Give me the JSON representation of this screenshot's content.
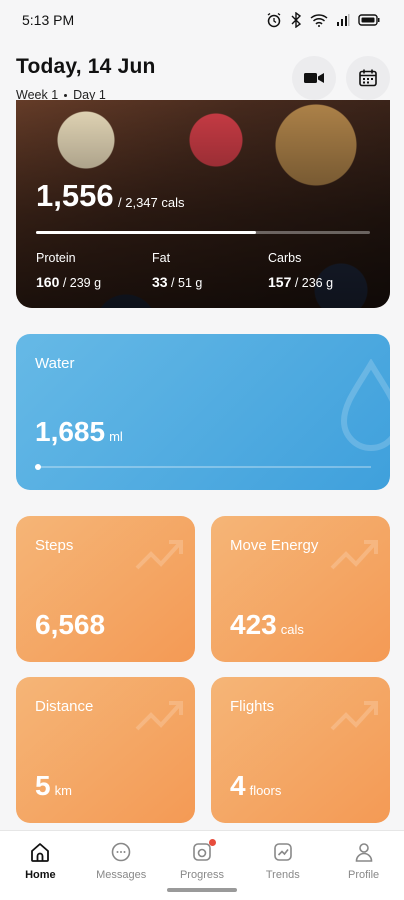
{
  "status_bar": {
    "time": "5:13 PM"
  },
  "header": {
    "title": "Today, 14 Jun",
    "week": "Week 1",
    "day": "Day 1"
  },
  "calories": {
    "consumed": "1,556",
    "goal": "/ 2,347 cals",
    "progress": 0.66,
    "macros": [
      {
        "label": "Protein",
        "value": "160",
        "target": " / 239 g"
      },
      {
        "label": "Fat",
        "value": "33",
        "target": " / 51 g"
      },
      {
        "label": "Carbs",
        "value": "157",
        "target": " / 236 g"
      }
    ]
  },
  "water": {
    "label": "Water",
    "value": "1,685",
    "unit": "ml",
    "progress": 0.0
  },
  "tiles": {
    "steps": {
      "label": "Steps",
      "value": "6,568",
      "unit": ""
    },
    "move": {
      "label": "Move Energy",
      "value": "423",
      "unit": "cals"
    },
    "distance": {
      "label": "Distance",
      "value": "5",
      "unit": "km"
    },
    "flights": {
      "label": "Flights",
      "value": "4",
      "unit": "floors"
    }
  },
  "nav": [
    {
      "label": "Home",
      "icon": "home-icon",
      "active": true
    },
    {
      "label": "Messages",
      "icon": "messages-icon",
      "active": false
    },
    {
      "label": "Progress",
      "icon": "camera-progress-icon",
      "active": false,
      "badge": true
    },
    {
      "label": "Trends",
      "icon": "trends-icon",
      "active": false
    },
    {
      "label": "Profile",
      "icon": "profile-icon",
      "active": false
    }
  ],
  "colors": {
    "water_card": "#46a6de",
    "activity_tile": "#f4a362",
    "badge": "#e74c3c"
  }
}
